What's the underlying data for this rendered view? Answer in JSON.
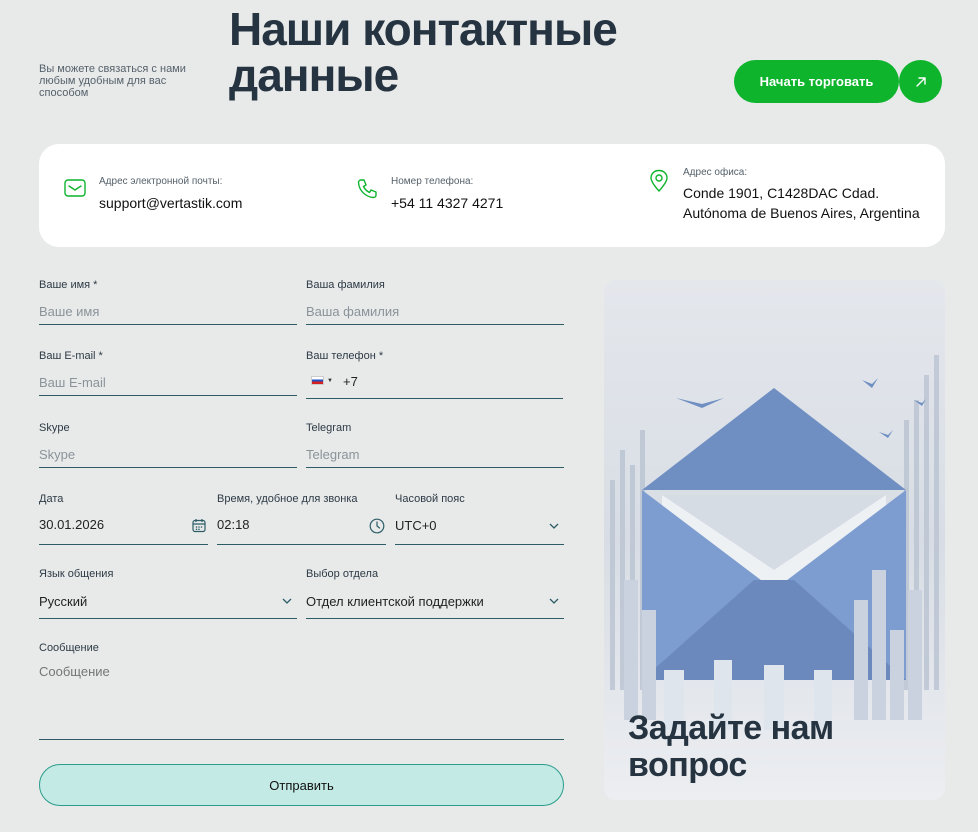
{
  "header": {
    "subtitle": "Вы можете связаться с нами любым удобным для вас способом",
    "title": "Наши контактные данные",
    "cta_label": "Начать торговать"
  },
  "contacts": {
    "email_label": "Адрес электронной почты:",
    "email_value": "support@vertastik.com",
    "phone_label": "Номер телефона:",
    "phone_value": "+54 11 4327 4271",
    "office_label": "Адрес офиса:",
    "office_line1": "Conde 1901, C1428DAC Cdad.",
    "office_line2": "Autónoma de Buenos Aires, Argentina"
  },
  "form": {
    "first_name": {
      "label": "Ваше имя *",
      "placeholder": "Ваше имя"
    },
    "last_name": {
      "label": "Ваша фамилия",
      "placeholder": "Ваша фамилия"
    },
    "email": {
      "label": "Ваш E-mail *",
      "placeholder": "Ваш E-mail"
    },
    "phone": {
      "label": "Ваш телефон *",
      "value": "+7"
    },
    "skype": {
      "label": "Skype",
      "placeholder": "Skype"
    },
    "telegram": {
      "label": "Telegram",
      "placeholder": "Telegram"
    },
    "date": {
      "label": "Дата",
      "value": "30.01.2026"
    },
    "time": {
      "label": "Время, удобное для звонка",
      "value": "02:18"
    },
    "timezone": {
      "label": "Часовой пояс",
      "value": "UTC+0"
    },
    "language": {
      "label": "Язык общения",
      "value": "Русский"
    },
    "department": {
      "label": "Выбор отдела",
      "value": "Отдел клиентской поддержки"
    },
    "message": {
      "label": "Сообщение",
      "placeholder": "Сообщение"
    },
    "submit_label": "Отправить"
  },
  "promo": {
    "title": "Задайте нам вопрос"
  },
  "colors": {
    "accent_green": "#0fb42d",
    "submit_bg": "#c3eae4",
    "heading": "#263441"
  }
}
